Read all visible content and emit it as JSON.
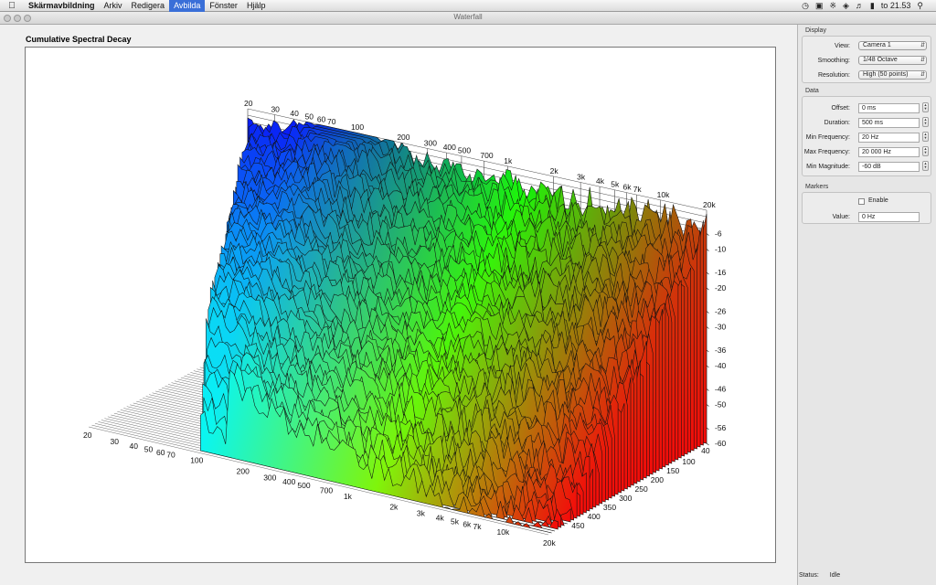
{
  "menubar": {
    "apple_icon": "apple-icon",
    "items": [
      "Skärmavbildning",
      "Arkiv",
      "Redigera",
      "Avbilda",
      "Fönster",
      "Hjälp"
    ],
    "active_index": 3,
    "clock": "to 21.53"
  },
  "window": {
    "title": "Waterfall"
  },
  "chart_title": "Cumulative Spectral Decay",
  "chart_data": {
    "type": "waterfall",
    "title": "Cumulative Spectral Decay",
    "back_freq_ticks": [
      "20",
      "30",
      "40",
      "50",
      "60",
      "70",
      "100",
      "200",
      "300",
      "400",
      "500",
      "700",
      "1k",
      "2k",
      "3k",
      "4k",
      "5k",
      "6k",
      "7k",
      "10k",
      "20k"
    ],
    "front_freq_ticks": [
      "20",
      "30",
      "40",
      "50",
      "60",
      "70",
      "100",
      "200",
      "300",
      "400",
      "500",
      "700",
      "1k",
      "2k",
      "3k",
      "4k",
      "5k",
      "6k",
      "7k",
      "10k",
      "20k"
    ],
    "freq_values": [
      20,
      30,
      40,
      50,
      60,
      70,
      100,
      200,
      300,
      400,
      500,
      700,
      1000,
      2000,
      3000,
      4000,
      5000,
      6000,
      7000,
      10000,
      20000
    ],
    "magnitude_ticks": [
      "-6",
      "-10",
      "-16",
      "-20",
      "-26",
      "-30",
      "-36",
      "-40",
      "-46",
      "-50",
      "-56",
      "-60"
    ],
    "magnitude_values": [
      -6,
      -10,
      -16,
      -20,
      -26,
      -30,
      -36,
      -40,
      -46,
      -50,
      -56,
      -60
    ],
    "time_ticks": [
      "40",
      "100",
      "150",
      "200",
      "250",
      "300",
      "350",
      "400",
      "450"
    ],
    "time_values": [
      40,
      100,
      150,
      200,
      250,
      300,
      350,
      400,
      450
    ],
    "freq_range": [
      20,
      20000
    ],
    "magnitude_range": [
      -60,
      0
    ],
    "time_range": [
      0,
      500
    ],
    "slice_count": 50
  },
  "sidebar": {
    "display": {
      "label": "Display",
      "view_label": "View:",
      "view_value": "Camera 1",
      "smoothing_label": "Smoothing:",
      "smoothing_value": "1/48 Octave",
      "resolution_label": "Resolution:",
      "resolution_value": "High (50 points)"
    },
    "data": {
      "label": "Data",
      "offset_label": "Offset:",
      "offset_value": "0 ms",
      "duration_label": "Duration:",
      "duration_value": "500 ms",
      "minfreq_label": "Min Frequency:",
      "minfreq_value": "20 Hz",
      "maxfreq_label": "Max Frequency:",
      "maxfreq_value": "20 000 Hz",
      "minmag_label": "Min Magnitude:",
      "minmag_value": "-60 dB"
    },
    "markers": {
      "label": "Markers",
      "enable_label": "Enable",
      "value_label": "Value:",
      "value_value": "0 Hz"
    }
  },
  "status": {
    "label": "Status:",
    "value": "Idle"
  }
}
